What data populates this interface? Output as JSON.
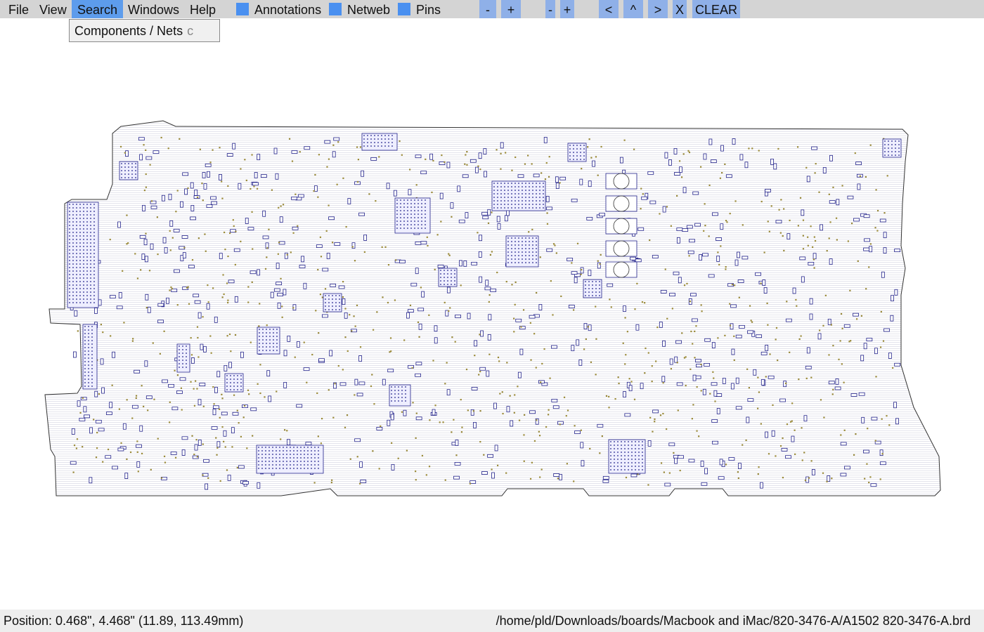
{
  "menu": {
    "file": "File",
    "view": "View",
    "search": "Search",
    "windows": "Windows",
    "help": "Help"
  },
  "toggles": {
    "annotations": "Annotations",
    "netweb": "Netweb",
    "pins": "Pins"
  },
  "toolbar": {
    "zoom_minus": "-",
    "zoom_plus": "+",
    "zoom2_minus": "-",
    "zoom2_plus": "+",
    "nav_left": "<",
    "nav_up": "^",
    "nav_right": ">",
    "close": "X",
    "clear": "CLEAR"
  },
  "search_menu": {
    "entry": "Components / Nets",
    "shortcut": "c"
  },
  "status": {
    "position": "Position: 0.468\", 4.468\" (11.89, 113.49mm)",
    "file_path": "/home/pld/Downloads/boards/Macbook and iMac/820-3476-A/A1502 820-3476-A.brd"
  },
  "colors": {
    "menubar": "#d4d4d4",
    "menu_active": "#5d9cec",
    "checkbox": "#4a90f0",
    "button": "#8fb0e8",
    "board_outline": "#333333",
    "component": "#22228a",
    "pad": "#9a8a3a"
  }
}
